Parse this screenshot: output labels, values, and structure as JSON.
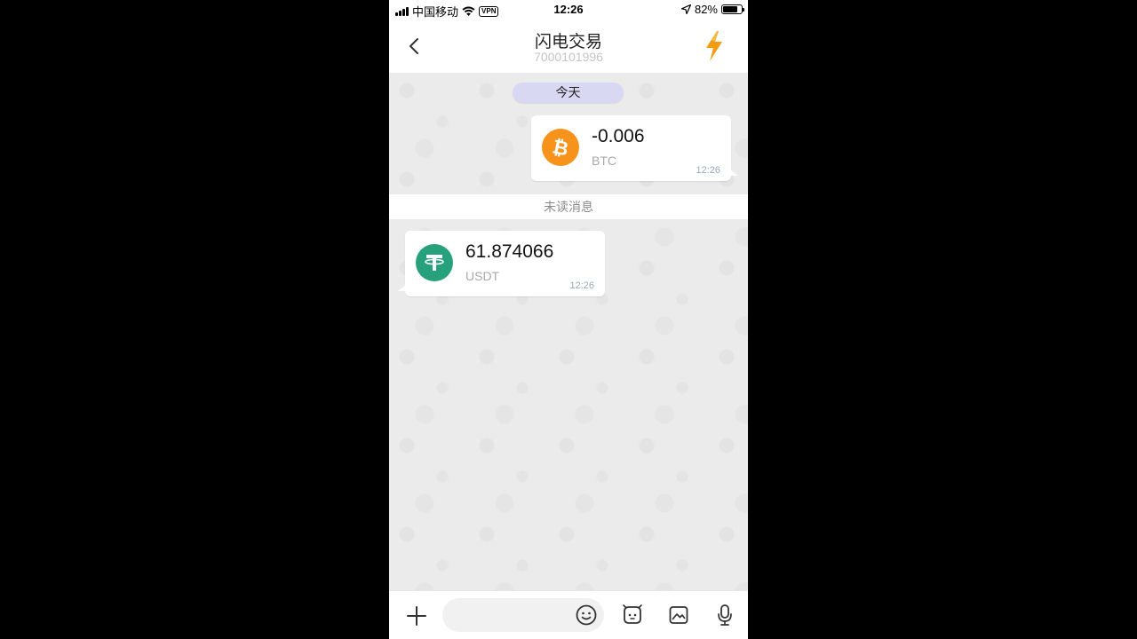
{
  "status_bar": {
    "carrier": "中国移动",
    "vpn": "VPN",
    "time": "12:26",
    "battery_percent": "82%",
    "battery_level": 0.82
  },
  "header": {
    "title": "闪电交易",
    "subtitle": "7000101996"
  },
  "chat": {
    "date_label": "今天",
    "unread_label": "未读消息",
    "messages": [
      {
        "direction": "outgoing",
        "amount": "-0.006",
        "symbol": "BTC",
        "time": "12:26"
      },
      {
        "direction": "incoming",
        "amount": "61.874066",
        "symbol": "USDT",
        "time": "12:26"
      }
    ]
  },
  "input_bar": {
    "placeholder": "",
    "icons": [
      "plus-icon",
      "emoji-icon",
      "sticker-icon",
      "image-icon",
      "microphone-icon"
    ]
  },
  "colors": {
    "btc": "#f7931a",
    "usdt": "#26a17b",
    "date_pill": "#d8d8f2",
    "bolt": "#f39c12"
  }
}
